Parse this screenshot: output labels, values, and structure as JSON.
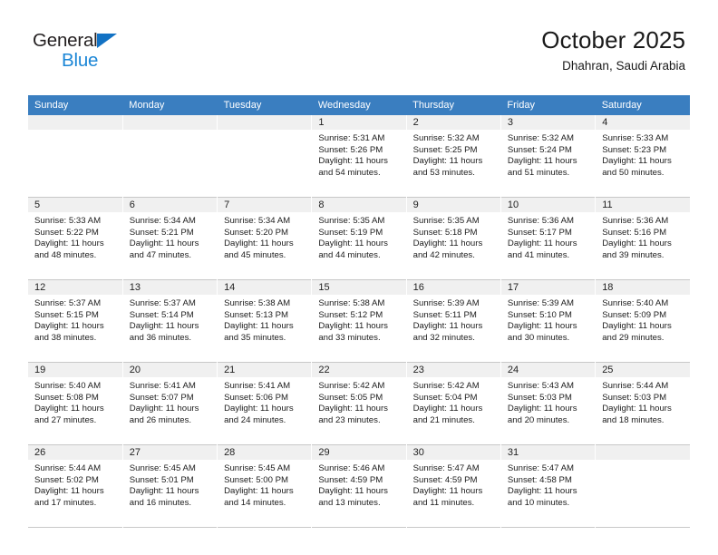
{
  "brand": {
    "name_part1": "General",
    "name_part2": "Blue",
    "triangle_icon": "triangle-icon",
    "accent_color": "#1b86d6"
  },
  "header": {
    "title": "October 2025",
    "location": "Dhahran, Saudi Arabia",
    "header_bg_color": "#3a7ec0",
    "daynum_band_color": "#f0f0f0"
  },
  "weekdays": [
    "Sunday",
    "Monday",
    "Tuesday",
    "Wednesday",
    "Thursday",
    "Friday",
    "Saturday"
  ],
  "labels": {
    "sunrise": "Sunrise:",
    "sunset": "Sunset:",
    "daylight": "Daylight:"
  },
  "weeks": [
    [
      {
        "day": ""
      },
      {
        "day": ""
      },
      {
        "day": ""
      },
      {
        "day": "1",
        "sunrise": "Sunrise: 5:31 AM",
        "sunset": "Sunset: 5:26 PM",
        "daylight1": "Daylight: 11 hours",
        "daylight2": "and 54 minutes."
      },
      {
        "day": "2",
        "sunrise": "Sunrise: 5:32 AM",
        "sunset": "Sunset: 5:25 PM",
        "daylight1": "Daylight: 11 hours",
        "daylight2": "and 53 minutes."
      },
      {
        "day": "3",
        "sunrise": "Sunrise: 5:32 AM",
        "sunset": "Sunset: 5:24 PM",
        "daylight1": "Daylight: 11 hours",
        "daylight2": "and 51 minutes."
      },
      {
        "day": "4",
        "sunrise": "Sunrise: 5:33 AM",
        "sunset": "Sunset: 5:23 PM",
        "daylight1": "Daylight: 11 hours",
        "daylight2": "and 50 minutes."
      }
    ],
    [
      {
        "day": "5",
        "sunrise": "Sunrise: 5:33 AM",
        "sunset": "Sunset: 5:22 PM",
        "daylight1": "Daylight: 11 hours",
        "daylight2": "and 48 minutes."
      },
      {
        "day": "6",
        "sunrise": "Sunrise: 5:34 AM",
        "sunset": "Sunset: 5:21 PM",
        "daylight1": "Daylight: 11 hours",
        "daylight2": "and 47 minutes."
      },
      {
        "day": "7",
        "sunrise": "Sunrise: 5:34 AM",
        "sunset": "Sunset: 5:20 PM",
        "daylight1": "Daylight: 11 hours",
        "daylight2": "and 45 minutes."
      },
      {
        "day": "8",
        "sunrise": "Sunrise: 5:35 AM",
        "sunset": "Sunset: 5:19 PM",
        "daylight1": "Daylight: 11 hours",
        "daylight2": "and 44 minutes."
      },
      {
        "day": "9",
        "sunrise": "Sunrise: 5:35 AM",
        "sunset": "Sunset: 5:18 PM",
        "daylight1": "Daylight: 11 hours",
        "daylight2": "and 42 minutes."
      },
      {
        "day": "10",
        "sunrise": "Sunrise: 5:36 AM",
        "sunset": "Sunset: 5:17 PM",
        "daylight1": "Daylight: 11 hours",
        "daylight2": "and 41 minutes."
      },
      {
        "day": "11",
        "sunrise": "Sunrise: 5:36 AM",
        "sunset": "Sunset: 5:16 PM",
        "daylight1": "Daylight: 11 hours",
        "daylight2": "and 39 minutes."
      }
    ],
    [
      {
        "day": "12",
        "sunrise": "Sunrise: 5:37 AM",
        "sunset": "Sunset: 5:15 PM",
        "daylight1": "Daylight: 11 hours",
        "daylight2": "and 38 minutes."
      },
      {
        "day": "13",
        "sunrise": "Sunrise: 5:37 AM",
        "sunset": "Sunset: 5:14 PM",
        "daylight1": "Daylight: 11 hours",
        "daylight2": "and 36 minutes."
      },
      {
        "day": "14",
        "sunrise": "Sunrise: 5:38 AM",
        "sunset": "Sunset: 5:13 PM",
        "daylight1": "Daylight: 11 hours",
        "daylight2": "and 35 minutes."
      },
      {
        "day": "15",
        "sunrise": "Sunrise: 5:38 AM",
        "sunset": "Sunset: 5:12 PM",
        "daylight1": "Daylight: 11 hours",
        "daylight2": "and 33 minutes."
      },
      {
        "day": "16",
        "sunrise": "Sunrise: 5:39 AM",
        "sunset": "Sunset: 5:11 PM",
        "daylight1": "Daylight: 11 hours",
        "daylight2": "and 32 minutes."
      },
      {
        "day": "17",
        "sunrise": "Sunrise: 5:39 AM",
        "sunset": "Sunset: 5:10 PM",
        "daylight1": "Daylight: 11 hours",
        "daylight2": "and 30 minutes."
      },
      {
        "day": "18",
        "sunrise": "Sunrise: 5:40 AM",
        "sunset": "Sunset: 5:09 PM",
        "daylight1": "Daylight: 11 hours",
        "daylight2": "and 29 minutes."
      }
    ],
    [
      {
        "day": "19",
        "sunrise": "Sunrise: 5:40 AM",
        "sunset": "Sunset: 5:08 PM",
        "daylight1": "Daylight: 11 hours",
        "daylight2": "and 27 minutes."
      },
      {
        "day": "20",
        "sunrise": "Sunrise: 5:41 AM",
        "sunset": "Sunset: 5:07 PM",
        "daylight1": "Daylight: 11 hours",
        "daylight2": "and 26 minutes."
      },
      {
        "day": "21",
        "sunrise": "Sunrise: 5:41 AM",
        "sunset": "Sunset: 5:06 PM",
        "daylight1": "Daylight: 11 hours",
        "daylight2": "and 24 minutes."
      },
      {
        "day": "22",
        "sunrise": "Sunrise: 5:42 AM",
        "sunset": "Sunset: 5:05 PM",
        "daylight1": "Daylight: 11 hours",
        "daylight2": "and 23 minutes."
      },
      {
        "day": "23",
        "sunrise": "Sunrise: 5:42 AM",
        "sunset": "Sunset: 5:04 PM",
        "daylight1": "Daylight: 11 hours",
        "daylight2": "and 21 minutes."
      },
      {
        "day": "24",
        "sunrise": "Sunrise: 5:43 AM",
        "sunset": "Sunset: 5:03 PM",
        "daylight1": "Daylight: 11 hours",
        "daylight2": "and 20 minutes."
      },
      {
        "day": "25",
        "sunrise": "Sunrise: 5:44 AM",
        "sunset": "Sunset: 5:03 PM",
        "daylight1": "Daylight: 11 hours",
        "daylight2": "and 18 minutes."
      }
    ],
    [
      {
        "day": "26",
        "sunrise": "Sunrise: 5:44 AM",
        "sunset": "Sunset: 5:02 PM",
        "daylight1": "Daylight: 11 hours",
        "daylight2": "and 17 minutes."
      },
      {
        "day": "27",
        "sunrise": "Sunrise: 5:45 AM",
        "sunset": "Sunset: 5:01 PM",
        "daylight1": "Daylight: 11 hours",
        "daylight2": "and 16 minutes."
      },
      {
        "day": "28",
        "sunrise": "Sunrise: 5:45 AM",
        "sunset": "Sunset: 5:00 PM",
        "daylight1": "Daylight: 11 hours",
        "daylight2": "and 14 minutes."
      },
      {
        "day": "29",
        "sunrise": "Sunrise: 5:46 AM",
        "sunset": "Sunset: 4:59 PM",
        "daylight1": "Daylight: 11 hours",
        "daylight2": "and 13 minutes."
      },
      {
        "day": "30",
        "sunrise": "Sunrise: 5:47 AM",
        "sunset": "Sunset: 4:59 PM",
        "daylight1": "Daylight: 11 hours",
        "daylight2": "and 11 minutes."
      },
      {
        "day": "31",
        "sunrise": "Sunrise: 5:47 AM",
        "sunset": "Sunset: 4:58 PM",
        "daylight1": "Daylight: 11 hours",
        "daylight2": "and 10 minutes."
      },
      {
        "day": ""
      }
    ]
  ]
}
